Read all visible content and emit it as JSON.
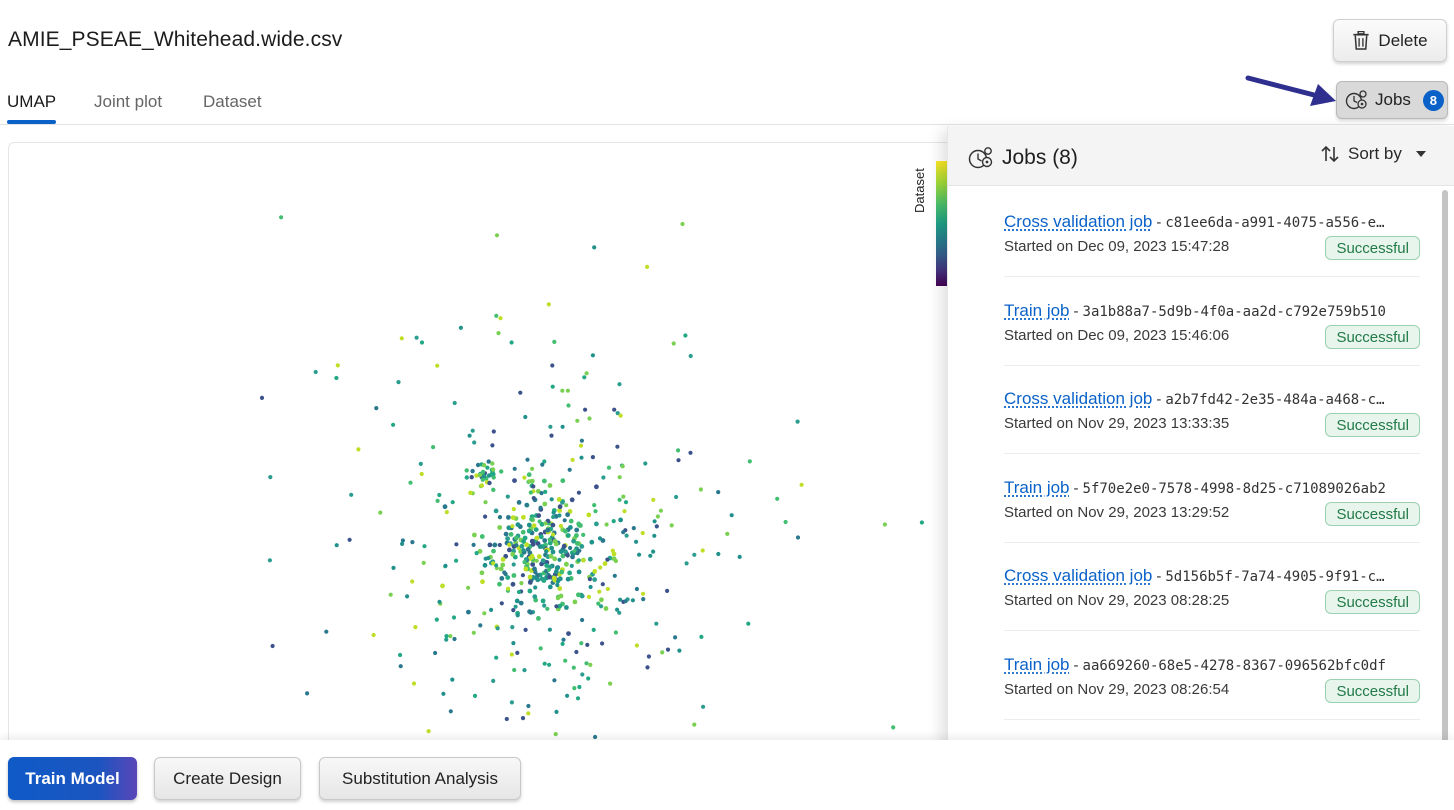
{
  "header": {
    "file_name": "AMIE_PSEAE_Whitehead.wide.csv",
    "delete_label": "Delete",
    "delete_icon": "trash-icon"
  },
  "tabs": [
    {
      "label": "UMAP",
      "active": true
    },
    {
      "label": "Joint plot",
      "active": false
    },
    {
      "label": "Dataset",
      "active": false
    }
  ],
  "jobs_button": {
    "label": "Jobs",
    "count": "8",
    "icon": "jobs-gear-icon"
  },
  "plot": {
    "colorbar_label": "Dataset",
    "colormap": [
      "#fde725",
      "#4ac16d",
      "#1fa187",
      "#365c8d",
      "#440154"
    ],
    "point_colors": [
      "#2a788e",
      "#22a884",
      "#42be71",
      "#7ad151",
      "#bddf26",
      "#2a9d8f",
      "#21918c",
      "#3b528b"
    ]
  },
  "jobs_panel": {
    "title": "Jobs (8)",
    "sort_label": "Sort by",
    "jobs": [
      {
        "type": "Cross validation job",
        "sep": "-",
        "id": "c81ee6da-a991-4075-a556-e…",
        "started": "Started on Dec 09, 2023 15:47:28",
        "status": "Successful"
      },
      {
        "type": "Train job",
        "sep": "-",
        "id": "3a1b88a7-5d9b-4f0a-aa2d-c792e759b510",
        "started": "Started on Dec 09, 2023 15:46:06",
        "status": "Successful"
      },
      {
        "type": "Cross validation job",
        "sep": "-",
        "id": "a2b7fd42-2e35-484a-a468-c…",
        "started": "Started on Nov 29, 2023 13:33:35",
        "status": "Successful"
      },
      {
        "type": "Train job",
        "sep": "-",
        "id": "5f70e2e0-7578-4998-8d25-c71089026ab2",
        "started": "Started on Nov 29, 2023 13:29:52",
        "status": "Successful"
      },
      {
        "type": "Cross validation job",
        "sep": "-",
        "id": "5d156b5f-7a74-4905-9f91-c…",
        "started": "Started on Nov 29, 2023 08:28:25",
        "status": "Successful"
      },
      {
        "type": "Train job",
        "sep": "-",
        "id": "aa669260-68e5-4278-8367-096562bfc0df",
        "started": "Started on Nov 29, 2023 08:26:54",
        "status": "Successful"
      }
    ]
  },
  "bottom_bar": {
    "train_label": "Train Model",
    "design_label": "Create Design",
    "substitution_label": "Substitution Analysis"
  }
}
